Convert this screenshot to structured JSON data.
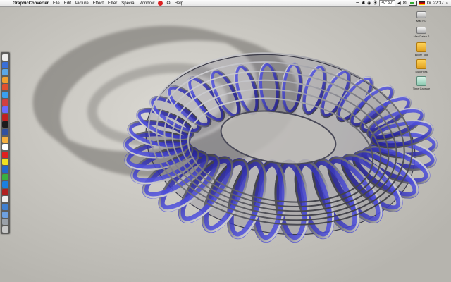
{
  "menubar": {
    "apple_glyph": "",
    "app_name": "GraphicConverter",
    "menus": [
      "File",
      "Edit",
      "Picture",
      "Effect",
      "Filter",
      "Special",
      "Window"
    ],
    "help": "Help",
    "red_badge": "",
    "script_glyph": "☊",
    "extras_left": [
      "☰",
      "✱",
      "◉",
      "⦿"
    ],
    "temperature": "40° 50°",
    "extras_right": [
      "◀︎",
      "✉"
    ],
    "clock": "Di. 22:37",
    "spotlight": "⌕"
  },
  "colors": {
    "desktop": "#c8c6c0",
    "menubar": "#f0f0f0",
    "torus_blue": "#2a2ad0",
    "torus_metal": "#6c6c72"
  },
  "desktop_icons": [
    {
      "name": "hard-drive-icon",
      "label": "Mac HD"
    },
    {
      "name": "hard-drive-2-icon",
      "label": "Mac Daten 2"
    },
    {
      "name": "folder-icon",
      "label": "Bilder Tool"
    },
    {
      "name": "folder-2-icon",
      "label": "Mail Files"
    },
    {
      "name": "monitor-icon",
      "label": "Time Capsule"
    }
  ]
}
